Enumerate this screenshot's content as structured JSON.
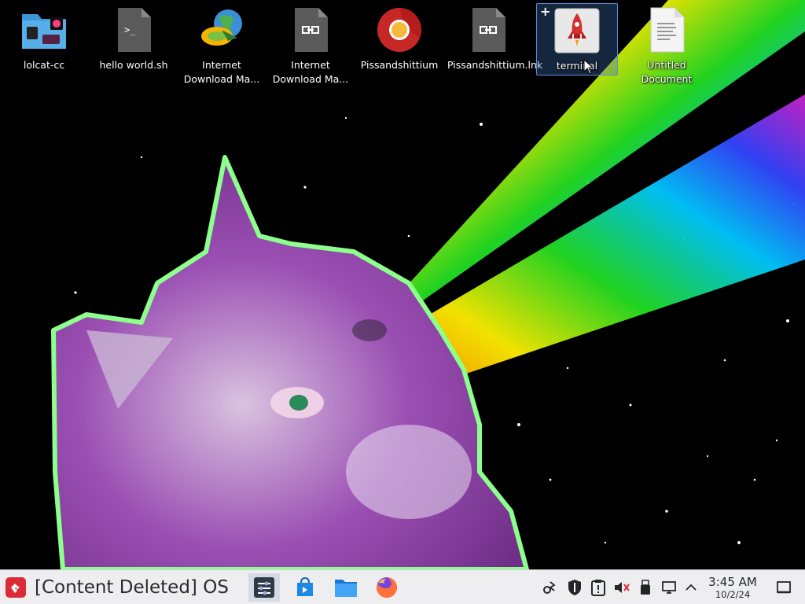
{
  "desktop": {
    "icons": [
      {
        "label": "lolcat-cc",
        "icon": "folder-icon"
      },
      {
        "label": "hello world.sh",
        "icon": "shell-script-icon"
      },
      {
        "label": "Internet Download Ma...",
        "icon": "internet-download-manager-icon"
      },
      {
        "label": "Internet Download Ma...",
        "icon": "shortcut-file-icon"
      },
      {
        "label": "Pissandshittium",
        "icon": "chromium-browser-icon"
      },
      {
        "label": "Pissandshittium.lnk",
        "icon": "shortcut-file-icon"
      },
      {
        "label": "terminal",
        "icon": "rocket-terminal-icon",
        "selected": true
      },
      {
        "label": "Untitled Document",
        "icon": "text-document-icon"
      }
    ],
    "wallpaper": "purple cat with rainbow laser eyes in starry space"
  },
  "taskbar": {
    "start_label": "[Content Deleted] OS",
    "start_icon": "os-logo-icon",
    "pinned": [
      {
        "name": "settings-mixer-icon"
      },
      {
        "name": "store-icon"
      },
      {
        "name": "file-manager-icon"
      },
      {
        "name": "firefox-icon"
      }
    ],
    "tray": [
      "bluetooth-icon",
      "security-shield-icon",
      "clipboard-icon",
      "volume-muted-icon",
      "usb-device-icon",
      "network-icon",
      "chevron-up-icon"
    ],
    "clock": {
      "time": "3:45 AM",
      "date": "10/2/24"
    },
    "show_desktop_icon": "show-desktop-icon"
  },
  "colors": {
    "accent": "#da2c38",
    "taskbar_bg": "#eeeef0",
    "selection": "#5b8ed6"
  }
}
